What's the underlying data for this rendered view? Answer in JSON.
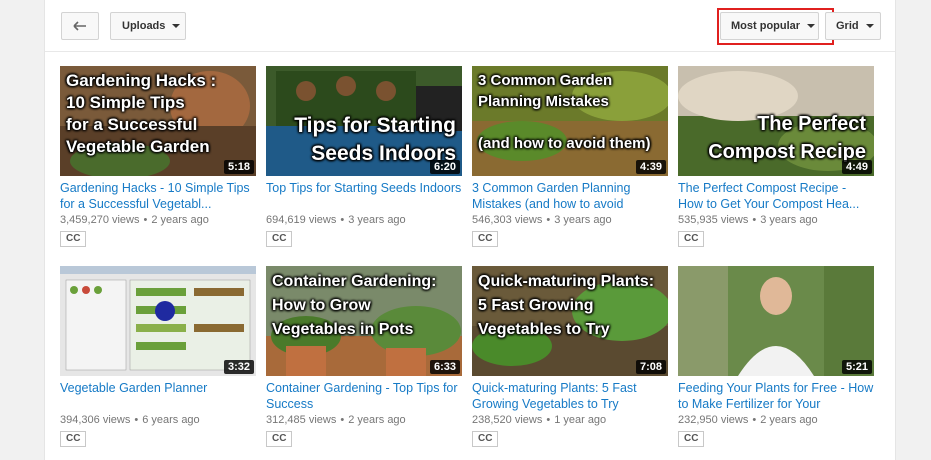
{
  "toolbar": {
    "uploads_label": "Uploads",
    "sort_label": "Most popular",
    "view_label": "Grid"
  },
  "videos": [
    {
      "overlay": "Gardening Hacks :\n10 Simple Tips\nfor a Successful\nVegetable Garden",
      "duration": "5:18",
      "title": "Gardening Hacks - 10 Simple Tips for a Successful Vegetabl...",
      "views": "3,459,270 views",
      "age": "2 years ago",
      "badge": "CC"
    },
    {
      "overlay": "Tips for Starting\nSeeds Indoors",
      "duration": "6:20",
      "title": "Top Tips for Starting Seeds Indoors",
      "views": "694,619 views",
      "age": "3 years ago",
      "badge": "CC"
    },
    {
      "overlay": "3 Common Garden\nPlanning Mistakes\n\n(and how to avoid them)",
      "duration": "4:39",
      "title": "3 Common Garden Planning Mistakes (and how to avoid",
      "views": "546,303 views",
      "age": "3 years ago",
      "badge": "CC"
    },
    {
      "overlay": "The Perfect\nCompost Recipe",
      "duration": "4:49",
      "title": "The Perfect Compost Recipe - How to Get Your Compost Hea...",
      "views": "535,935 views",
      "age": "3 years ago",
      "badge": "CC"
    },
    {
      "overlay": "",
      "duration": "3:32",
      "title": "Vegetable Garden Planner",
      "views": "394,306 views",
      "age": "6 years ago",
      "badge": "CC"
    },
    {
      "overlay": "Container Gardening:\nHow to Grow\nVegetables in Pots",
      "duration": "6:33",
      "title": "Container Gardening - Top Tips for Success",
      "views": "312,485 views",
      "age": "2 years ago",
      "badge": "CC"
    },
    {
      "overlay": "Quick-maturing Plants:\n5 Fast Growing\nVegetables to Try",
      "duration": "7:08",
      "title": "Quick-maturing Plants: 5 Fast Growing Vegetables to Try",
      "views": "238,520 views",
      "age": "1 year ago",
      "badge": "CC"
    },
    {
      "overlay": "",
      "duration": "5:21",
      "title": "Feeding Your Plants for Free - How to Make Fertilizer for Your",
      "views": "232,950 views",
      "age": "2 years ago",
      "badge": "CC"
    }
  ]
}
